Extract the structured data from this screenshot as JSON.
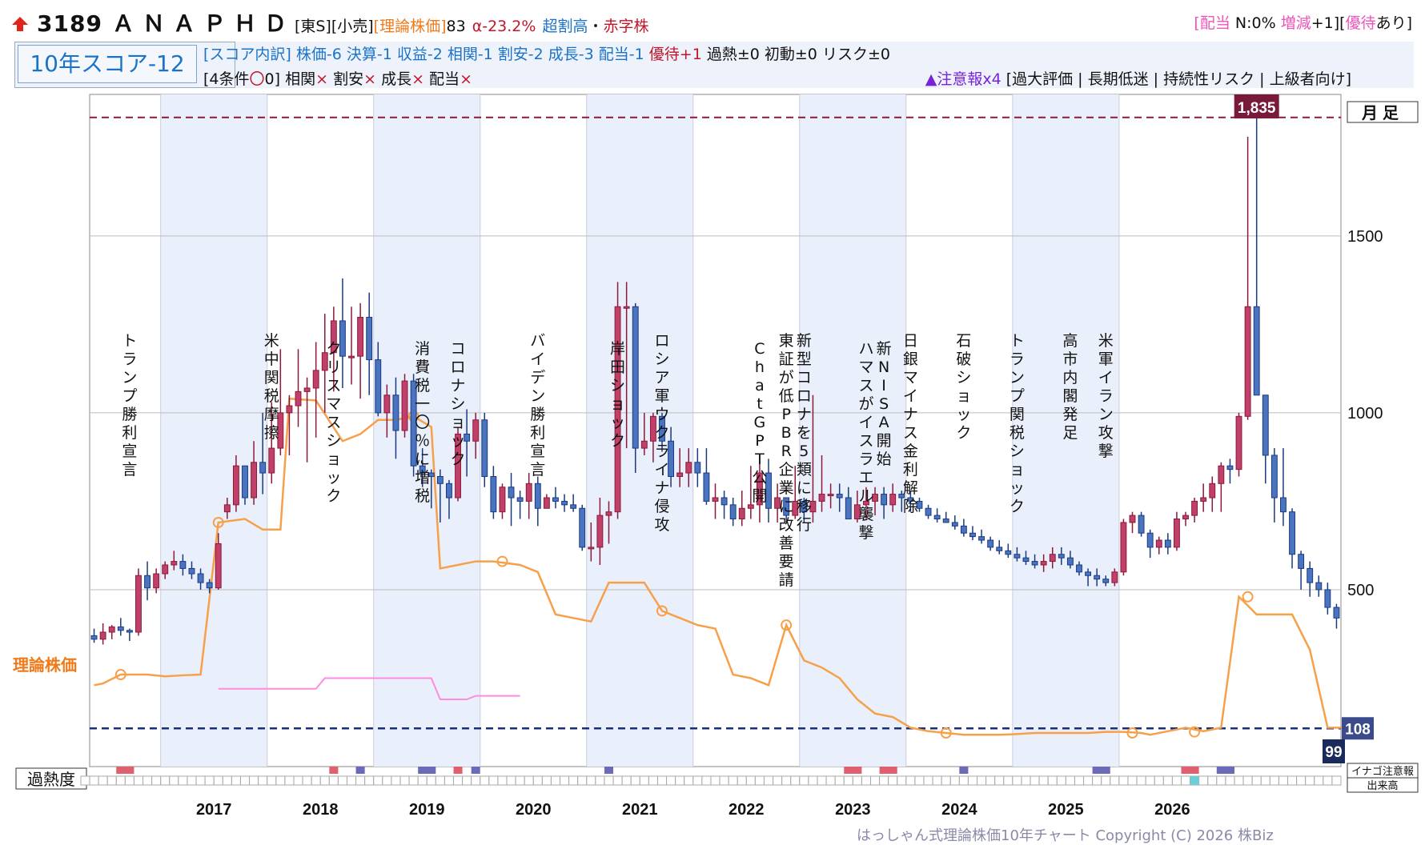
{
  "header": {
    "ticker": "3189",
    "name": "ＡＮＡＰＨＤ",
    "market": "[東S]",
    "sector": "[小売]",
    "theory_label": "[理論株価]",
    "theory_rank": "83",
    "alpha": "α-23.2%",
    "valuation": "超割高",
    "dot": "・",
    "profit": "赤字株",
    "right_b1": "[",
    "right_div": "配当",
    "right_n": " N:0% ",
    "right_incdec": "増減",
    "right_plus": "+1",
    "right_b2": "][",
    "right_yutai": "優待",
    "right_ari": "あり]"
  },
  "score": {
    "big": "10年スコア-12",
    "breakdown_label": "[スコア内訳]",
    "breakdown_blue": "株価-6 決算-1 収益-2 相関-1 割安-2 成長-3 配当-1",
    "breakdown_red": "優待+1",
    "breakdown_rest": "過熱±0 初動±0 リスク±0",
    "cond_label": "[4条件",
    "cond_mark": "〇",
    "cond_count": "0]",
    "cond_items": [
      {
        "name": "相関",
        "mark": "×"
      },
      {
        "name": "割安",
        "mark": "×"
      },
      {
        "name": "成長",
        "mark": "×"
      },
      {
        "name": "配当",
        "mark": "×"
      }
    ],
    "warn_purple": "▲注意報x4",
    "warn_rest": "[過大評価 | 長期低迷 | 持続性リスク | 上級者向け]"
  },
  "chart_data": {
    "type": "candlestick",
    "frequency": "月足",
    "ylim": [
      0,
      1900
    ],
    "yticks": [
      500,
      1000,
      1500
    ],
    "x_years": [
      "2017",
      "2018",
      "2019",
      "2020",
      "2021",
      "2022",
      "2023",
      "2024",
      "2025",
      "2026"
    ],
    "shaded_years": [
      "2017",
      "2019",
      "2021",
      "2023",
      "2025"
    ],
    "high_label": "1,835",
    "high_value": 1835,
    "current_label": "108",
    "current_value": 108,
    "theory_value_label": "99",
    "theory_series_name": "理論株価",
    "candles_ohlc": [
      [
        370,
        390,
        350,
        360
      ],
      [
        360,
        405,
        345,
        380
      ],
      [
        380,
        400,
        360,
        395
      ],
      [
        395,
        420,
        370,
        385
      ],
      [
        385,
        390,
        355,
        380
      ],
      [
        380,
        560,
        370,
        540
      ],
      [
        540,
        580,
        470,
        505
      ],
      [
        505,
        560,
        490,
        545
      ],
      [
        545,
        580,
        530,
        570
      ],
      [
        570,
        610,
        555,
        580
      ],
      [
        580,
        600,
        540,
        560
      ],
      [
        560,
        580,
        530,
        545
      ],
      [
        545,
        560,
        500,
        520
      ],
      [
        520,
        530,
        490,
        505
      ],
      [
        505,
        660,
        500,
        630
      ],
      [
        720,
        760,
        700,
        740
      ],
      [
        740,
        880,
        720,
        850
      ],
      [
        850,
        850,
        740,
        760
      ],
      [
        760,
        920,
        740,
        860
      ],
      [
        860,
        1000,
        770,
        830
      ],
      [
        830,
        1030,
        800,
        900
      ],
      [
        900,
        1180,
        880,
        1000
      ],
      [
        1000,
        1050,
        880,
        1020
      ],
      [
        1020,
        1180,
        960,
        1060
      ],
      [
        1060,
        1100,
        860,
        1070
      ],
      [
        1070,
        1200,
        930,
        1120
      ],
      [
        1120,
        1280,
        1000,
        1170
      ],
      [
        1170,
        1300,
        1060,
        1260
      ],
      [
        1260,
        1380,
        1070,
        1160
      ],
      [
        1160,
        1300,
        1080,
        1160
      ],
      [
        1160,
        1310,
        1040,
        1270
      ],
      [
        1270,
        1340,
        1050,
        1150
      ],
      [
        1150,
        1200,
        990,
        1000
      ],
      [
        1000,
        1080,
        930,
        1050
      ],
      [
        1050,
        1100,
        870,
        950
      ],
      [
        950,
        1110,
        930,
        1090
      ],
      [
        1090,
        1110,
        820,
        850
      ],
      [
        850,
        900,
        790,
        830
      ],
      [
        830,
        840,
        730,
        820
      ],
      [
        820,
        840,
        690,
        800
      ],
      [
        800,
        810,
        700,
        760
      ],
      [
        760,
        960,
        750,
        940
      ],
      [
        940,
        1010,
        820,
        920
      ],
      [
        920,
        1000,
        870,
        980
      ],
      [
        980,
        1000,
        790,
        820
      ],
      [
        820,
        850,
        700,
        720
      ],
      [
        720,
        800,
        700,
        790
      ],
      [
        790,
        830,
        680,
        760
      ],
      [
        760,
        780,
        700,
        750
      ],
      [
        750,
        830,
        700,
        800
      ],
      [
        800,
        820,
        680,
        730
      ],
      [
        730,
        770,
        730,
        760
      ],
      [
        760,
        790,
        730,
        750
      ],
      [
        750,
        770,
        720,
        740
      ],
      [
        740,
        770,
        720,
        730
      ],
      [
        730,
        740,
        610,
        620
      ],
      [
        620,
        690,
        580,
        620
      ],
      [
        620,
        760,
        570,
        710
      ],
      [
        710,
        750,
        630,
        720
      ],
      [
        720,
        1370,
        700,
        1300
      ],
      [
        1300,
        1370,
        900,
        1300
      ],
      [
        1300,
        1310,
        830,
        900
      ],
      [
        900,
        1000,
        880,
        920
      ],
      [
        920,
        1000,
        860,
        990
      ],
      [
        990,
        1000,
        890,
        920
      ],
      [
        920,
        960,
        790,
        820
      ],
      [
        820,
        900,
        790,
        830
      ],
      [
        830,
        900,
        790,
        860
      ],
      [
        860,
        900,
        790,
        830
      ],
      [
        830,
        900,
        740,
        750
      ],
      [
        750,
        800,
        700,
        760
      ],
      [
        760,
        780,
        700,
        740
      ],
      [
        740,
        760,
        680,
        700
      ],
      [
        700,
        780,
        680,
        730
      ],
      [
        730,
        850,
        700,
        740
      ],
      [
        740,
        870,
        690,
        830
      ],
      [
        830,
        870,
        690,
        730
      ],
      [
        730,
        800,
        690,
        760
      ],
      [
        760,
        740,
        690,
        710
      ],
      [
        710,
        850,
        700,
        750
      ],
      [
        750,
        760,
        690,
        720
      ],
      [
        720,
        1050,
        690,
        750
      ],
      [
        750,
        880,
        720,
        770
      ],
      [
        770,
        800,
        730,
        770
      ],
      [
        770,
        800,
        720,
        760
      ],
      [
        760,
        790,
        730,
        700
      ],
      [
        700,
        780,
        690,
        740
      ],
      [
        740,
        790,
        700,
        750
      ],
      [
        750,
        790,
        710,
        770
      ],
      [
        770,
        790,
        700,
        740
      ],
      [
        740,
        800,
        720,
        770
      ],
      [
        770,
        780,
        720,
        760
      ],
      [
        760,
        780,
        720,
        750
      ],
      [
        750,
        760,
        720,
        730
      ],
      [
        730,
        740,
        700,
        710
      ],
      [
        710,
        730,
        690,
        700
      ],
      [
        700,
        720,
        690,
        690
      ],
      [
        690,
        710,
        670,
        680
      ],
      [
        680,
        700,
        650,
        660
      ],
      [
        660,
        680,
        640,
        650
      ],
      [
        650,
        670,
        630,
        640
      ],
      [
        640,
        650,
        610,
        620
      ],
      [
        620,
        640,
        600,
        610
      ],
      [
        610,
        630,
        590,
        600
      ],
      [
        600,
        620,
        580,
        590
      ],
      [
        590,
        610,
        570,
        580
      ],
      [
        580,
        600,
        560,
        570
      ],
      [
        570,
        600,
        550,
        580
      ],
      [
        580,
        620,
        560,
        600
      ],
      [
        600,
        620,
        570,
        590
      ],
      [
        590,
        610,
        560,
        570
      ],
      [
        570,
        580,
        540,
        550
      ],
      [
        550,
        560,
        510,
        540
      ],
      [
        540,
        560,
        510,
        530
      ],
      [
        530,
        540,
        510,
        520
      ],
      [
        520,
        560,
        510,
        550
      ],
      [
        550,
        700,
        540,
        690
      ],
      [
        690,
        720,
        660,
        710
      ],
      [
        710,
        720,
        650,
        660
      ],
      [
        660,
        670,
        590,
        620
      ],
      [
        620,
        650,
        600,
        640
      ],
      [
        640,
        660,
        600,
        620
      ],
      [
        620,
        720,
        610,
        700
      ],
      [
        700,
        720,
        680,
        710
      ],
      [
        710,
        760,
        690,
        750
      ],
      [
        750,
        800,
        720,
        760
      ],
      [
        760,
        820,
        720,
        800
      ],
      [
        800,
        860,
        720,
        850
      ],
      [
        850,
        870,
        800,
        840
      ],
      [
        840,
        1000,
        820,
        990
      ],
      [
        990,
        1780,
        980,
        1300
      ],
      [
        1300,
        1835,
        1280,
        1050
      ],
      [
        1050,
        1020,
        800,
        880
      ],
      [
        880,
        900,
        690,
        760
      ],
      [
        760,
        900,
        680,
        720
      ],
      [
        720,
        730,
        560,
        600
      ],
      [
        600,
        610,
        500,
        560
      ],
      [
        560,
        580,
        480,
        520
      ],
      [
        520,
        540,
        480,
        500
      ],
      [
        500,
        520,
        430,
        450
      ],
      [
        450,
        460,
        390,
        420
      ]
    ],
    "theory_line": [
      [
        0,
        230
      ],
      [
        1,
        235
      ],
      [
        3,
        260
      ],
      [
        6,
        260
      ],
      [
        8,
        255
      ],
      [
        10,
        258
      ],
      [
        12,
        260
      ],
      [
        14,
        690
      ],
      [
        17,
        700
      ],
      [
        19,
        670
      ],
      [
        21,
        670
      ],
      [
        22,
        1040
      ],
      [
        25,
        1035
      ],
      [
        28,
        920
      ],
      [
        30,
        940
      ],
      [
        32,
        980
      ],
      [
        34,
        980
      ],
      [
        36,
        990
      ],
      [
        38,
        960
      ],
      [
        39,
        560
      ],
      [
        41,
        570
      ],
      [
        43,
        580
      ],
      [
        45,
        580
      ],
      [
        48,
        570
      ],
      [
        50,
        550
      ],
      [
        52,
        430
      ],
      [
        54,
        420
      ],
      [
        56,
        410
      ],
      [
        58,
        520
      ],
      [
        60,
        520
      ],
      [
        62,
        520
      ],
      [
        64,
        440
      ],
      [
        66,
        420
      ],
      [
        68,
        400
      ],
      [
        70,
        390
      ],
      [
        72,
        260
      ],
      [
        74,
        250
      ],
      [
        76,
        230
      ],
      [
        78,
        400
      ],
      [
        80,
        300
      ],
      [
        82,
        280
      ],
      [
        84,
        250
      ],
      [
        86,
        190
      ],
      [
        88,
        150
      ],
      [
        90,
        140
      ],
      [
        92,
        110
      ],
      [
        94,
        100
      ],
      [
        96,
        95
      ],
      [
        98,
        90
      ],
      [
        100,
        90
      ],
      [
        102,
        90
      ],
      [
        104,
        92
      ],
      [
        106,
        95
      ],
      [
        108,
        95
      ],
      [
        110,
        95
      ],
      [
        112,
        95
      ],
      [
        114,
        98
      ],
      [
        116,
        98
      ],
      [
        118,
        95
      ],
      [
        119,
        90
      ],
      [
        121,
        100
      ],
      [
        123,
        110
      ],
      [
        125,
        100
      ],
      [
        127,
        110
      ],
      [
        129,
        480
      ],
      [
        131,
        430
      ],
      [
        133,
        430
      ],
      [
        135,
        430
      ],
      [
        137,
        330
      ],
      [
        139,
        110
      ],
      [
        141,
        110
      ]
    ],
    "theory_markers": [
      [
        3,
        260
      ],
      [
        14,
        690
      ],
      [
        36,
        990
      ],
      [
        46,
        580
      ],
      [
        64,
        440
      ],
      [
        78,
        400
      ],
      [
        96,
        95
      ],
      [
        117,
        95
      ],
      [
        124,
        98
      ],
      [
        130,
        480
      ]
    ],
    "pink_line": [
      [
        14,
        220
      ],
      [
        25,
        220
      ],
      [
        26,
        250
      ],
      [
        38,
        250
      ],
      [
        39,
        190
      ],
      [
        42,
        190
      ],
      [
        43,
        200
      ],
      [
        48,
        200
      ]
    ],
    "ref_levels": {
      "high": 1835,
      "current": 108
    },
    "heat_boxes": {
      "red": [
        [
          3,
          4
        ],
        [
          27,
          27
        ],
        [
          41,
          41
        ],
        [
          85,
          86
        ],
        [
          89,
          90
        ],
        [
          123,
          124
        ]
      ],
      "purple": [
        [
          30,
          30
        ],
        [
          37,
          38
        ],
        [
          43,
          43
        ],
        [
          58,
          58
        ],
        [
          98,
          98
        ],
        [
          113,
          114
        ],
        [
          127,
          128
        ]
      ],
      "cyan": [
        [
          124,
          124
        ]
      ]
    },
    "legend_heat": "過熱度",
    "legend_warn": "イナゴ注意報",
    "legend_vol": "出来高"
  },
  "events": [
    {
      "label": "トランプ勝利宣言",
      "idx": 4
    },
    {
      "label": "米中関税摩擦",
      "idx": 20
    },
    {
      "label": "クリスマスショック",
      "idx": 27
    },
    {
      "label": "消費税一〇％に増税",
      "idx": 37
    },
    {
      "label": "コロナショック",
      "idx": 41
    },
    {
      "label": "バイデン勝利宣言",
      "idx": 50
    },
    {
      "label": "岸田ショック",
      "idx": 59
    },
    {
      "label": "ロシア軍ウクライナ侵攻",
      "idx": 64
    },
    {
      "label": "ChatGPT公開",
      "idx": 75
    },
    {
      "label": "東証が低PBR企業に改善要請",
      "idx": 78
    },
    {
      "label": "新型コロナを5類に移行",
      "idx": 80
    },
    {
      "label": "ハマスがイスラエル襲撃",
      "idx": 87
    },
    {
      "label": "新NISA開始",
      "idx": 89
    },
    {
      "label": "日銀マイナス金利解除",
      "idx": 92
    },
    {
      "label": "石破ショック",
      "idx": 98
    },
    {
      "label": "トランプ関税ショック",
      "idx": 104
    },
    {
      "label": "高市内閣発足",
      "idx": 110
    },
    {
      "label": "米軍イラン攻撃",
      "idx": 114
    }
  ],
  "footer": "はっしゃん式理論株価10年チャート Copyright (C) 2026 株Biz"
}
